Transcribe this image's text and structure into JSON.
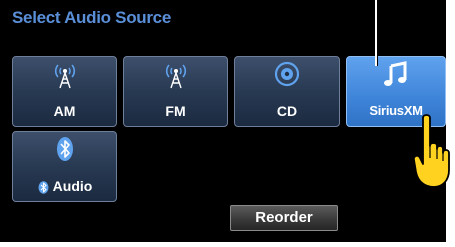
{
  "screen": {
    "title": "Select Audio Source"
  },
  "sources": [
    {
      "label": "AM",
      "icon": "radio-tower-icon",
      "active": false
    },
    {
      "label": "FM",
      "icon": "radio-tower-icon",
      "active": false
    },
    {
      "label": "CD",
      "icon": "disc-icon",
      "active": false
    },
    {
      "label": "SiriusXM",
      "icon": "music-note-icon",
      "active": true
    },
    {
      "label": "Audio",
      "icon": "bluetooth-icon",
      "active": false
    }
  ],
  "reorder_label": "Reorder",
  "colors": {
    "screen_background": "#000000",
    "title_text": "#5a8fd8",
    "tile_background": "#283952",
    "tile_active_background": "#3e84d8",
    "icon_accent": "#5fa2ee",
    "hand_fill": "#ffd21f"
  }
}
